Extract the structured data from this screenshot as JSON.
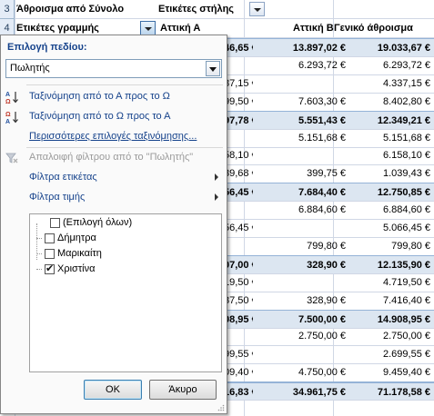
{
  "sheet": {
    "row3": {
      "num": "3",
      "label": "Άθροισμα από Σύνολο",
      "col_label": "Ετικέτες στήλης"
    },
    "row4": {
      "num": "4",
      "row_label": "Ετικέτες γραμμής",
      "col_a": "Αττική Α",
      "col_b": "Αττική Β",
      "col_g": "Γενικό άθροισμα"
    },
    "rows": [
      {
        "type": "sub",
        "a": "46,65 €",
        "b": "13.897,02 €",
        "g": "19.033,67 €"
      },
      {
        "type": "data",
        "a": "",
        "b": "6.293,72 €",
        "g": "6.293,72 €"
      },
      {
        "type": "data",
        "a": "87,15 €",
        "b": "",
        "g": "4.337,15 €"
      },
      {
        "type": "data",
        "a": "99,50 €",
        "b": "7.603,30 €",
        "g": "8.402,80 €"
      },
      {
        "type": "sub",
        "a": "97,78 €",
        "b": "5.551,43 €",
        "g": "12.349,21 €"
      },
      {
        "type": "data",
        "a": "",
        "b": "5.151,68 €",
        "g": "5.151,68 €"
      },
      {
        "type": "data",
        "a": "58,10 €",
        "b": "",
        "g": "6.158,10 €"
      },
      {
        "type": "data",
        "a": "39,68 €",
        "b": "399,75 €",
        "g": "1.039,43 €"
      },
      {
        "type": "sub",
        "a": "56,45 €",
        "b": "7.684,40 €",
        "g": "12.750,85 €"
      },
      {
        "type": "data",
        "a": "",
        "b": "6.884,60 €",
        "g": "6.884,60 €"
      },
      {
        "type": "data",
        "a": "56,45 €",
        "b": "",
        "g": "5.066,45 €"
      },
      {
        "type": "data",
        "a": "",
        "b": "799,80 €",
        "g": "799,80 €"
      },
      {
        "type": "sub",
        "a": "07,00 €",
        "b": "328,90 €",
        "g": "12.135,90 €"
      },
      {
        "type": "data",
        "a": "19,50 €",
        "b": "",
        "g": "4.719,50 €"
      },
      {
        "type": "data",
        "a": "37,50 €",
        "b": "328,90 €",
        "g": "7.416,40 €"
      },
      {
        "type": "sub",
        "a": "08,95 €",
        "b": "7.500,00 €",
        "g": "14.908,95 €"
      },
      {
        "type": "data",
        "a": "",
        "b": "2.750,00 €",
        "g": "2.750,00 €"
      },
      {
        "type": "data",
        "a": "99,55 €",
        "b": "",
        "g": "2.699,55 €"
      },
      {
        "type": "data",
        "a": "09,40 €",
        "b": "4.750,00 €",
        "g": "9.459,40 €"
      },
      {
        "type": "tot",
        "a": "16,83 €",
        "b": "34.961,75 €",
        "g": "71.178,58 €"
      }
    ]
  },
  "popup": {
    "field_label": "Επιλογή πεδίου:",
    "field_value": "Πωλητής",
    "menu": {
      "sort_az": "Ταξινόμηση από το Α προς το Ω",
      "sort_za": "Ταξινόμηση από το Ω προς το Α",
      "more_sort": "Περισσότερες επιλογές ταξινόμησης...",
      "clear_filter": "Απαλοιφή φίλτρου από το \"Πωλητής\"",
      "label_filters": "Φίλτρα ετικέτας",
      "value_filters": "Φίλτρα τιμής"
    },
    "list": [
      {
        "label": "(Επιλογή όλων)",
        "checked": false
      },
      {
        "label": "Δήμητρα",
        "checked": false
      },
      {
        "label": "Μαρικαίτη",
        "checked": false
      },
      {
        "label": "Χριστίνα",
        "checked": true
      }
    ],
    "ok_label": "OK",
    "cancel_label": "Άκυρο"
  },
  "icons": {
    "sort_az": "sort-ascending-icon",
    "sort_za": "sort-descending-icon",
    "clear_filter": "clear-filter-icon",
    "dropdown": "chevron-down-icon"
  }
}
